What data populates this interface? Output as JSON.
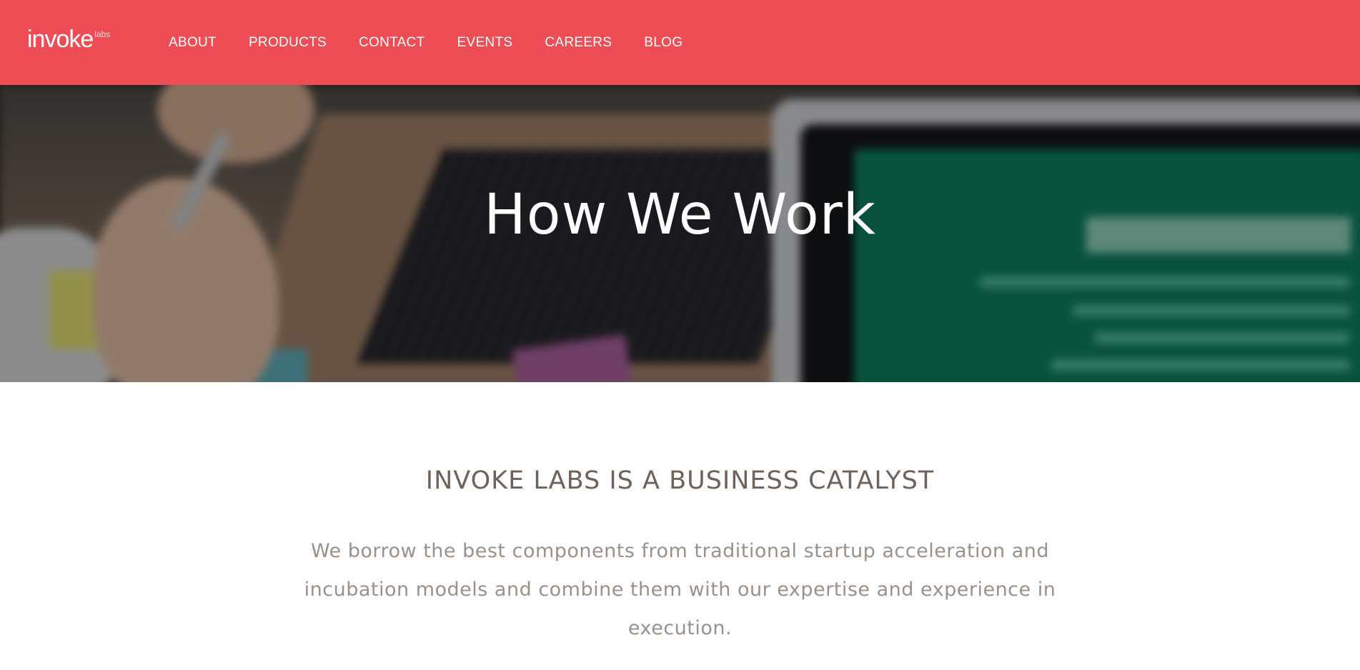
{
  "header": {
    "logo": {
      "text": "invoke",
      "superscript": "labs"
    },
    "nav": [
      {
        "label": "ABOUT"
      },
      {
        "label": "PRODUCTS"
      },
      {
        "label": "CONTACT"
      },
      {
        "label": "EVENTS"
      },
      {
        "label": "CAREERS"
      },
      {
        "label": "BLOG"
      }
    ]
  },
  "hero": {
    "title": "How We Work"
  },
  "content": {
    "heading": "INVOKE LABS IS A BUSINESS CATALYST",
    "body": "We borrow the best components from traditional startup acceleration and incubation models and combine them with our expertise and experience in execution."
  },
  "colors": {
    "brand": "#ee4d55",
    "heading": "#6e625a",
    "body_text": "#9a918b"
  }
}
